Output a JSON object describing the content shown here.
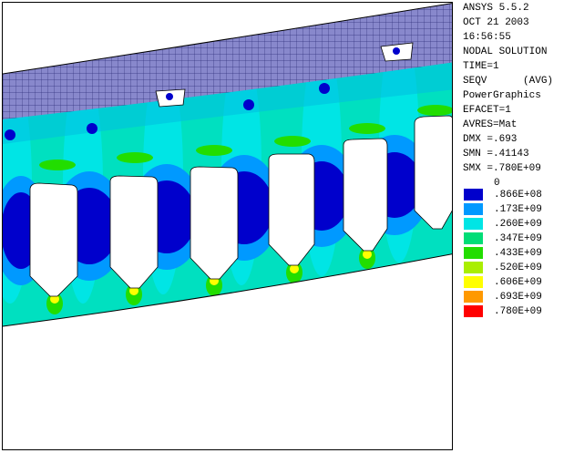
{
  "header": {
    "lines": [
      "ANSYS 5.5.2",
      "OCT 21 2003",
      "16:56:55",
      "NODAL SOLUTION",
      "TIME=1",
      "SEQV      (AVG)",
      "PowerGraphics",
      "EFACET=1",
      "AVRES=Mat",
      "DMX =.693",
      "SMN =.41143",
      "SMX =.780E+09"
    ]
  },
  "legend": {
    "zero_label": "0",
    "bands": [
      {
        "value": ".866E+08",
        "color": "#0000cc"
      },
      {
        "value": ".173E+09",
        "color": "#0099ff"
      },
      {
        "value": ".260E+09",
        "color": "#00e5e5"
      },
      {
        "value": ".347E+09",
        "color": "#00dd77"
      },
      {
        "value": ".433E+09",
        "color": "#22dd00"
      },
      {
        "value": ".520E+09",
        "color": "#aaee00"
      },
      {
        "value": ".606E+09",
        "color": "#ffff00"
      },
      {
        "value": ".693E+09",
        "color": "#ff9900"
      },
      {
        "value": ".780E+09",
        "color": "#ff0000"
      }
    ]
  },
  "colors": {
    "ring_base": "#00e0c0",
    "mesh_band": "#8888cc",
    "mesh_line": "#1a1a66",
    "slot": "#ffffff"
  }
}
